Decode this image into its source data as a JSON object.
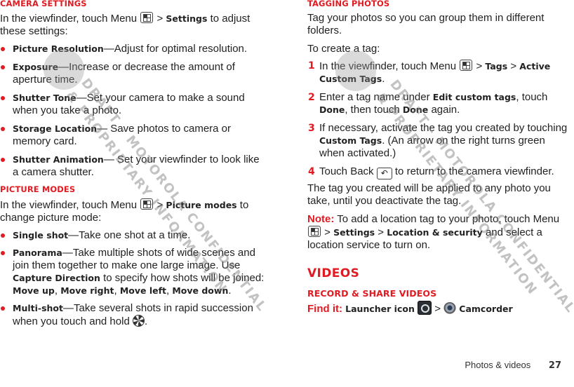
{
  "left": {
    "camera_settings": {
      "heading": "Camera Settings",
      "intro_pre": "In the viewfinder, touch Menu",
      "intro_sep": ">",
      "intro_bold": "Settings",
      "intro_post": "to adjust these settings:",
      "items": [
        {
          "term": "Picture Resolution",
          "desc": "—Adjust for optimal resolution."
        },
        {
          "term": "Exposure",
          "desc": "—Increase or decrease the amount of aperture time."
        },
        {
          "term": "Shutter Tone",
          "desc": "—Set your camera to make a sound when you take a photo."
        },
        {
          "term": "Storage Location",
          "desc": "— Save photos to camera or memory card."
        },
        {
          "term": "Shutter Animation",
          "desc": "— Set your viewfinder to look like a camera shutter."
        }
      ]
    },
    "picture_modes": {
      "heading": "Picture Modes",
      "intro_pre": "In the viewfinder, touch Menu",
      "intro_sep": ">",
      "intro_bold": "Picture modes",
      "intro_post": "to change picture mode:",
      "single_term": "Single shot",
      "single_desc": "—Take one shot at a time.",
      "pano_term": "Panorama",
      "pano_desc": "—Take multiple shots of wide scenes and join them together to make one large image. Use",
      "pano_cap": "Capture Direction",
      "pano_desc2": "to specify how shots will be joined:",
      "pano_opts": [
        "Move up",
        "Move right",
        "Move left",
        "Move down"
      ],
      "multi_term": "Multi-shot",
      "multi_desc": "—Take several shots in rapid succession when you touch and hold",
      "multi_end": "."
    }
  },
  "right": {
    "tagging": {
      "heading": "Tagging Photos",
      "intro": "Tag your photos so you can group them in different folders.",
      "create": "To create a tag:",
      "steps": [
        {
          "num": "1",
          "pre": "In the viewfinder, touch Menu",
          "sep1": ">",
          "b1": "Tags",
          "sep2": ">",
          "b2": "Active Custom Tags",
          "end": "."
        },
        {
          "num": "2",
          "pre": "Enter a tag name under",
          "b1": "Edit custom tags",
          "mid": ", touch",
          "b2": "Done",
          "mid2": ", then touch",
          "b3": "Done",
          "end": "again."
        },
        {
          "num": "3",
          "pre": "If necessary, activate the tag you created by touching",
          "b1": "Custom Tags",
          "end": ". (An arrow on the right turns green when activated.)"
        },
        {
          "num": "4",
          "pre": "Touch Back",
          "end": "to return to the camera viewfinder."
        }
      ],
      "applied": "The tag you created will be applied to any photo you take, until you deactivate the tag.",
      "note_label": "Note:",
      "note_pre": "To add a location tag to your photo, touch Menu",
      "note_sep1": ">",
      "note_b1": "Settings",
      "note_sep2": ">",
      "note_b2": "Location & security",
      "note_post": "and select a location service to turn on."
    },
    "videos": {
      "heading": "Videos",
      "subheading": "Record & Share Videos",
      "find_label": "Find it:",
      "find_launcher": "Launcher icon",
      "find_sep": ">",
      "find_app": "Camcorder"
    }
  },
  "footer": {
    "section": "Photos & videos",
    "page": "27"
  },
  "watermark": {
    "line1": "DRAFT - MOTOROLA CONFIDENTIAL",
    "line2": "& PROPRIETARY INFORMATION"
  },
  "icons": {
    "menu": "menu-key-icon",
    "back": "↶",
    "shutter": "shutter-icon",
    "launcher": "launcher-icon",
    "camcorder": "camcorder-icon"
  },
  "colors": {
    "accent_red": "#e01b22",
    "text": "#222222"
  }
}
